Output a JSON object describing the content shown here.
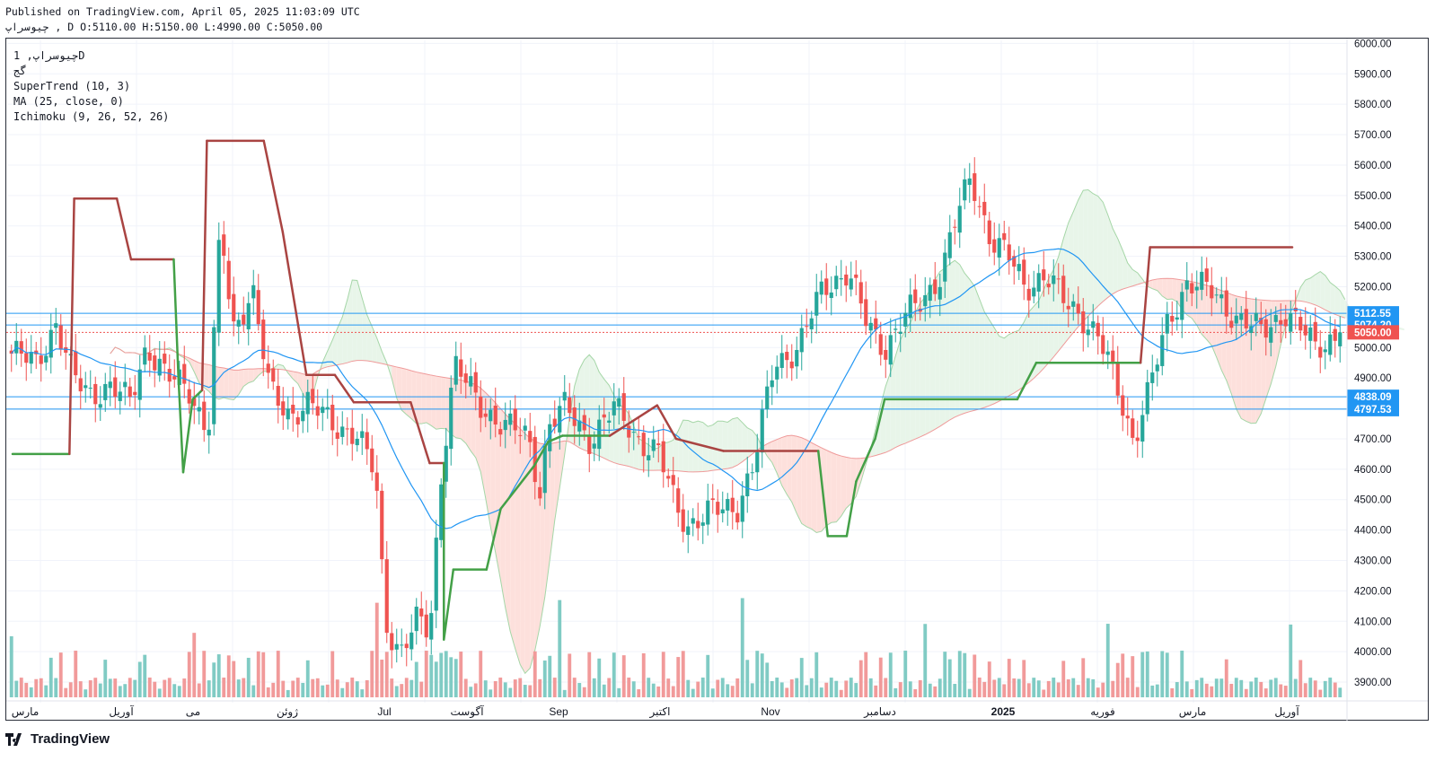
{
  "header": {
    "published": "Published on TradingView.com, April 05, 2025 11:03:09 UTC",
    "ohlc": "چیوسراپ , D O:5110.00 H:5150.00 L:4990.00 C:5050.00"
  },
  "legend": {
    "symbol": "چیوسراپ, 1D",
    "exchange": "گج",
    "indicator1": "SuperTrend (10, 3)",
    "indicator2": "MA (25, close, 0)",
    "indicator3": "Ichimoku (9, 26, 52, 26)"
  },
  "footer": {
    "brand": "TradingView"
  },
  "colors": {
    "up": "#26a69a",
    "down": "#ef5350",
    "st_up": "#43a047",
    "st_down": "#a94442",
    "ma": "#2196f3",
    "kumo_up": "#e8f5e9",
    "kumo_down": "#fde0dc",
    "hline": "#2196f3"
  },
  "chart_data": {
    "type": "candlestick",
    "ylim": [
      3850,
      6010
    ],
    "y_ticks": [
      3900,
      4000,
      4100,
      4200,
      4300,
      4400,
      4500,
      4600,
      4700,
      4800,
      4900,
      5000,
      5100,
      5200,
      5300,
      5400,
      5500,
      5600,
      5700,
      5800,
      5900,
      6000
    ],
    "x_labels": [
      "مارس",
      "آوریل",
      "می",
      "ژوئن",
      "Jul",
      "آگوست",
      "Sep",
      "اکتبر",
      "Nov",
      "دسامبر",
      "2025",
      "فوریه",
      "مارس",
      "آوریل"
    ],
    "price_labels": [
      {
        "value": 5112.55,
        "label": "5112.55",
        "color": "#2196f3"
      },
      {
        "value": 5074.2,
        "label": "5074.20",
        "color": "#2196f3"
      },
      {
        "value": 5050.0,
        "label": "5050.00",
        "color": "#ef5350"
      },
      {
        "value": 4838.09,
        "label": "4838.09",
        "color": "#2196f3"
      },
      {
        "value": 4797.53,
        "label": "4797.53",
        "color": "#2196f3"
      }
    ],
    "last_close": 5050,
    "candle_count": 270,
    "anchors": [
      [
        0,
        4980
      ],
      [
        10,
        4950
      ],
      [
        18,
        5080
      ],
      [
        25,
        4900
      ],
      [
        32,
        4850
      ],
      [
        40,
        4870
      ],
      [
        48,
        4820
      ],
      [
        55,
        5010
      ],
      [
        63,
        4900
      ],
      [
        72,
        4870
      ],
      [
        80,
        4720
      ],
      [
        85,
        5400
      ],
      [
        90,
        5050
      ],
      [
        98,
        5200
      ],
      [
        105,
        4850
      ],
      [
        113,
        4780
      ],
      [
        120,
        4820
      ],
      [
        130,
        4750
      ],
      [
        140,
        4720
      ],
      [
        148,
        4580
      ],
      [
        152,
        4100
      ],
      [
        158,
        4000
      ],
      [
        165,
        4100
      ],
      [
        170,
        4060
      ],
      [
        175,
        4620
      ],
      [
        180,
        4950
      ],
      [
        190,
        4810
      ],
      [
        200,
        4750
      ],
      [
        210,
        4700
      ],
      [
        215,
        4530
      ],
      [
        218,
        4750
      ],
      [
        225,
        4800
      ],
      [
        235,
        4700
      ],
      [
        245,
        4800
      ],
      [
        255,
        4700
      ],
      [
        263,
        4650
      ],
      [
        270,
        4480
      ],
      [
        275,
        4420
      ],
      [
        285,
        4460
      ],
      [
        295,
        4480
      ],
      [
        302,
        4620
      ],
      [
        310,
        4950
      ],
      [
        320,
        5000
      ],
      [
        330,
        5200
      ],
      [
        340,
        5250
      ],
      [
        348,
        5070
      ],
      [
        355,
        5000
      ],
      [
        363,
        5100
      ],
      [
        370,
        5150
      ],
      [
        378,
        5250
      ],
      [
        383,
        5400
      ],
      [
        390,
        5560
      ],
      [
        398,
        5360
      ],
      [
        405,
        5300
      ],
      [
        412,
        5200
      ],
      [
        420,
        5240
      ],
      [
        428,
        5150
      ],
      [
        435,
        5110
      ],
      [
        442,
        5030
      ],
      [
        448,
        4900
      ],
      [
        452,
        4800
      ],
      [
        456,
        4700
      ],
      [
        462,
        4850
      ],
      [
        470,
        5080
      ],
      [
        478,
        5220
      ],
      [
        488,
        5180
      ],
      [
        498,
        5100
      ],
      [
        508,
        5050
      ],
      [
        518,
        5120
      ],
      [
        530,
        5000
      ],
      [
        540,
        5050
      ]
    ],
    "supertrend": [
      [
        0,
        4650,
        "up"
      ],
      [
        12,
        4650,
        "up"
      ],
      [
        13,
        5490,
        "down"
      ],
      [
        22,
        5490,
        "down"
      ],
      [
        25,
        5290,
        "down"
      ],
      [
        34,
        5290,
        "down"
      ],
      [
        35,
        4900,
        "up"
      ],
      [
        36,
        4590,
        "up"
      ],
      [
        38,
        4830,
        "up"
      ],
      [
        40,
        4860,
        "up"
      ],
      [
        41,
        5680,
        "down"
      ],
      [
        53,
        5680,
        "down"
      ],
      [
        57,
        5380,
        "down"
      ],
      [
        62,
        4910,
        "down"
      ],
      [
        68,
        4910,
        "down"
      ],
      [
        72,
        4820,
        "down"
      ],
      [
        84,
        4820,
        "down"
      ],
      [
        88,
        4620,
        "down"
      ],
      [
        91,
        4620,
        "down"
      ],
      [
        91,
        4040,
        "up"
      ],
      [
        93,
        4270,
        "up"
      ],
      [
        100,
        4270,
        "up"
      ],
      [
        103,
        4470,
        "up"
      ],
      [
        110,
        4610,
        "up"
      ],
      [
        113,
        4690,
        "up"
      ],
      [
        116,
        4710,
        "up"
      ],
      [
        122,
        4710,
        "up"
      ],
      [
        126,
        4710,
        "up"
      ],
      [
        136,
        4810,
        "down"
      ],
      [
        140,
        4700,
        "down"
      ],
      [
        150,
        4660,
        "down"
      ],
      [
        170,
        4660,
        "down"
      ],
      [
        172,
        4380,
        "up"
      ],
      [
        176,
        4380,
        "up"
      ],
      [
        178,
        4560,
        "up"
      ],
      [
        182,
        4700,
        "up"
      ],
      [
        184,
        4830,
        "up"
      ],
      [
        212,
        4830,
        "up"
      ],
      [
        216,
        4950,
        "up"
      ],
      [
        238,
        4950,
        "up"
      ],
      [
        240,
        5330,
        "down"
      ],
      [
        270,
        5330,
        "down"
      ]
    ]
  }
}
